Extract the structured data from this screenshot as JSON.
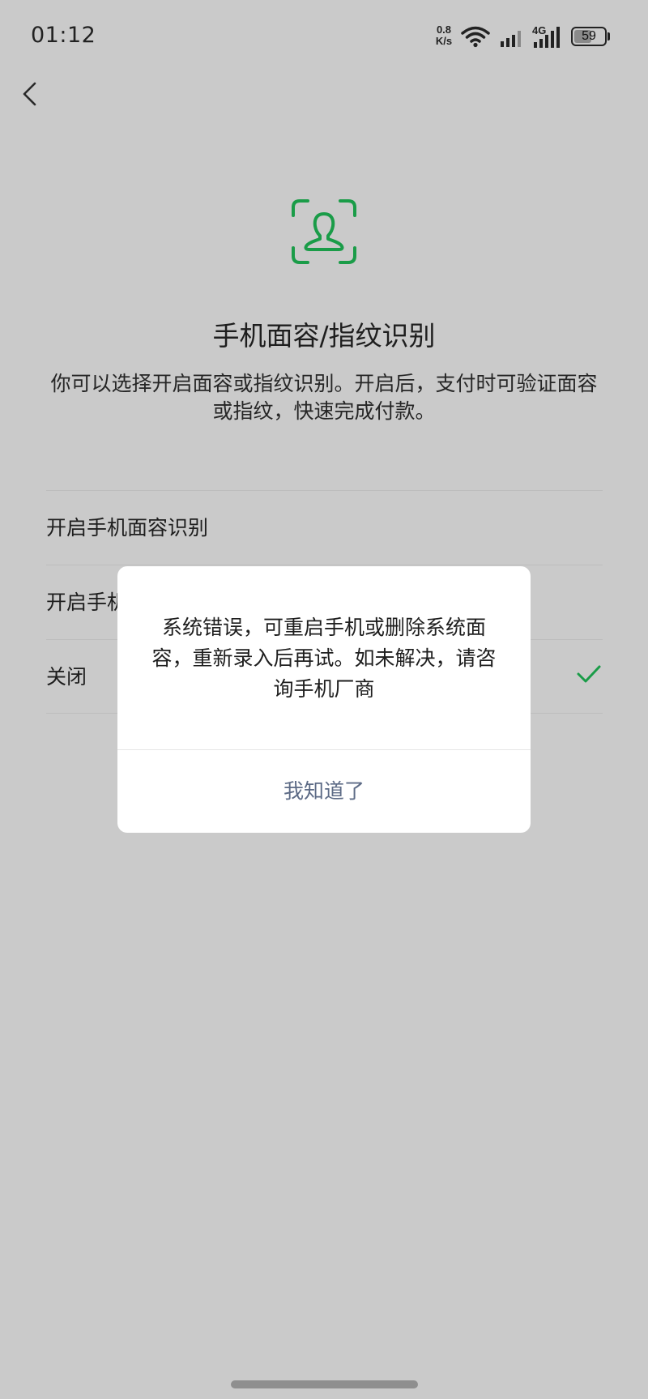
{
  "status_bar": {
    "time": "01:12",
    "net_speed_value": "0.8",
    "net_speed_unit": "K/s",
    "network_type": "4G",
    "battery_level": "59",
    "icons": [
      "wifi-icon",
      "signal-icon",
      "signal-4g-icon",
      "battery-icon"
    ]
  },
  "nav": {
    "back_icon": "chevron-left-icon"
  },
  "header": {
    "icon": "face-scan-icon",
    "icon_color": "#1a9c48",
    "title": "手机面容/指纹识别",
    "description": "你可以选择开启面容或指纹识别。开启后，支付时可验证面容或指纹，快速完成付款。"
  },
  "options": [
    {
      "label": "开启手机面容识别",
      "selected": false
    },
    {
      "label": "开启手机",
      "selected": false
    },
    {
      "label": "关闭",
      "selected": true
    }
  ],
  "dialog": {
    "message": "系统错误，可重启手机或删除系统面容，重新录入后再试。如未解决，请咨询手机厂商",
    "button_label": "我知道了",
    "button_color": "#5d6b86"
  },
  "colors": {
    "accent": "#1a9c48",
    "background": "#cacaca"
  }
}
